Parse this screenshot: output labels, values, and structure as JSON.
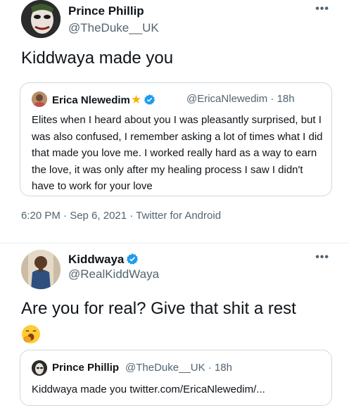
{
  "tweet1": {
    "display_name": "Prince Phillip",
    "handle": "@TheDuke__UK",
    "more": "•••",
    "text": "Kiddwaya made you",
    "quote": {
      "display_name": "Erica Nlewedim",
      "name_emoji": "★",
      "handle_time": "@EricaNlewedim · 18h",
      "text": "Elites when I heard about you I was pleasantly surprised, but I was also confused, I remember asking a lot of times what I did that made you love me. I worked really hard as a way to earn the love, it was only after my healing process I saw I didn't have to work for your love"
    },
    "meta": "6:20 PM · Sep 6, 2021 · Twitter for Android"
  },
  "tweet2": {
    "display_name": "Kiddwaya",
    "handle": "@RealKiddWaya",
    "more": "•••",
    "text": "Are you for real? Give that shit a rest",
    "emoji": "yawning-face",
    "quote": {
      "display_name": "Prince Phillip",
      "handle_time": "@TheDuke__UK · 18h",
      "text": "Kiddwaya made you twitter.com/EricaNlewedim/..."
    }
  },
  "colors": {
    "text": "#0f1419",
    "secondary": "#536471",
    "verified": "#1d9bf0",
    "border": "#cfd9de"
  }
}
